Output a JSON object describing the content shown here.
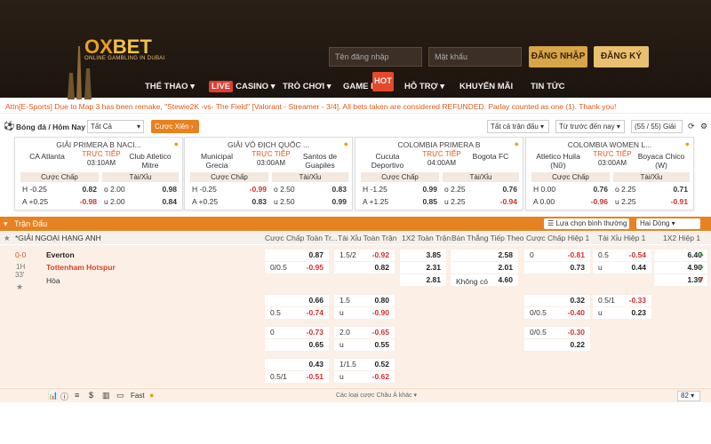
{
  "brand": {
    "logo_main": "OX",
    "logo_accent": "BET",
    "tagline": "ONLINE GAMBLING IN DUBAI"
  },
  "login": {
    "username_placeholder": "Tên đăng nhập",
    "password_placeholder": "Mật khẩu",
    "login_label": "ĐĂNG NHẬP",
    "register_label": "ĐĂNG KÝ"
  },
  "nav": {
    "items": [
      "THỂ THAO",
      "CASINO",
      "TRÒ CHƠI",
      "GAME BÀI",
      "HỖ TRỢ",
      "KHUYẾN MÃI",
      "TIN TỨC"
    ],
    "live_badge": "LIVE",
    "hot_badge": "HOT"
  },
  "ticker": "Attn[E-Sports] Due to Map 3 has been remake, \"Stewie2K -vs- The Field\" [Valorant - Streamer - 3/4]. All bets taken are considered REFUNDED. Parlay counted as one (1). Thank you!",
  "filters": {
    "sport_label": "Bóng đá / Hôm Nay",
    "league_value": "Tất Cả",
    "parlay_label": "Cược Xiên",
    "all_matches": "Tất cả trận đấu",
    "sort_value": "Từ trước đến nay",
    "count": "(55 / 55) Giải"
  },
  "cards": [
    {
      "league": "GIẢI PRIMERA B NACI...",
      "home": "CA Atlanta",
      "away": "Club Atletico Mitre",
      "live": "TRỰC TIẾP",
      "time": "03:10AM",
      "hdp_label": "Cược Chấp",
      "ou_label": "Tài/Xỉu",
      "rows": [
        [
          "H -0.25",
          "0.82",
          "o 2.00",
          "0.98"
        ],
        [
          "A +0.25",
          "-0.98",
          "u 2.00",
          "0.84"
        ]
      ]
    },
    {
      "league": "GIẢI VÔ ĐỊCH QUỐC ...",
      "home": "Municipal Grecia",
      "away": "Santos de Guapiles",
      "live": "TRỰC TIẾP",
      "time": "03:00AM",
      "hdp_label": "Cược Chấp",
      "ou_label": "Tài/Xỉu",
      "rows": [
        [
          "H -0.25",
          "-0.99",
          "o 2.50",
          "0.83"
        ],
        [
          "A +0.25",
          "0.83",
          "u 2.50",
          "0.99"
        ]
      ]
    },
    {
      "league": "COLOMBIA PRIMERA B",
      "home": "Cucuta Deportivo",
      "away": "Bogota FC",
      "live": "TRỰC TIẾP",
      "time": "04:00AM",
      "hdp_label": "Cược Chấp",
      "ou_label": "Tài/Xỉu",
      "rows": [
        [
          "H -1.25",
          "0.99",
          "o 2.25",
          "0.76"
        ],
        [
          "A +1.25",
          "0.85",
          "u 2.25",
          "-0.94"
        ]
      ]
    },
    {
      "league": "COLOMBIA WOMEN L...",
      "home": "Atletico Huila (Nữ)",
      "away": "Boyaca Chico (W)",
      "live": "TRỰC TIẾP",
      "time": "03:00AM",
      "hdp_label": "Cược Chấp",
      "ou_label": "Tài/Xỉu",
      "rows": [
        [
          "H 0.00",
          "0.76",
          "o 2.25",
          "0.71"
        ],
        [
          "A 0.00",
          "-0.96",
          "u 2.25",
          "-0.91"
        ]
      ]
    }
  ],
  "section": {
    "title": "Trận Đấu",
    "view_label": "Lựa chọn bình thường",
    "odds_type": "Hai Dòng"
  },
  "columns": [
    "Cược Chấp Toàn Tr...",
    "Tài Xỉu Toàn Trận",
    "1X2 Toàn Trận",
    "Bàn Thắng Tiếp Theo",
    "Cược Chấp Hiệp 1",
    "Tài Xỉu Hiệp 1",
    "1X2 Hiệp 1"
  ],
  "league_row": "*GIẢI NGOẠI HẠNG ANH",
  "match": {
    "score_home": "0",
    "score_away": "0",
    "period": "1H",
    "minute": "33'",
    "home": "Everton",
    "away": "Tottenham Hotspur",
    "draw": "Hòa",
    "no_goal": "Không có"
  },
  "odds": {
    "r1": [
      [
        "",
        "0.87"
      ],
      [
        "1.5/2",
        "-0.92"
      ],
      [
        "",
        "3.85"
      ],
      [
        "",
        "2.58"
      ],
      [
        "0",
        "-0.81"
      ],
      [
        "0.5",
        "-0.54"
      ],
      [
        "",
        "6.40"
      ]
    ],
    "r2": [
      [
        "0/0.5",
        "-0.95"
      ],
      [
        "",
        "0.82"
      ],
      [
        "",
        "2.31"
      ],
      [
        "",
        "2.01"
      ],
      [
        "",
        "0.73"
      ],
      [
        "u",
        "0.44"
      ],
      [
        "",
        "4.90"
      ]
    ],
    "r3": [
      [
        "",
        "2.81"
      ],
      [
        "",
        "4.60"
      ],
      [
        "",
        "1.39"
      ]
    ],
    "b2": [
      [
        "",
        "0.66"
      ],
      [
        "1.5",
        "0.80"
      ],
      [
        "",
        "0.32"
      ],
      [
        "0.5/1",
        "-0.33"
      ],
      [
        "0.5",
        "-0.74"
      ],
      [
        "u",
        "-0.90"
      ],
      [
        "0/0.5",
        "-0.40"
      ],
      [
        "u",
        "0.23"
      ]
    ],
    "b3": [
      [
        "0",
        "-0.73"
      ],
      [
        "2.0",
        "-0.65"
      ],
      [
        "0/0.5",
        "-0.30"
      ],
      [
        "",
        "0.65"
      ],
      [
        "u",
        "0.55"
      ],
      [
        "",
        "0.22"
      ]
    ],
    "b4": [
      [
        "",
        "0.43"
      ],
      [
        "1/1.5",
        "0.52"
      ],
      [
        "0.5/1",
        "-0.51"
      ],
      [
        "u",
        "-0.62"
      ]
    ]
  },
  "footer": {
    "more_label": "Các loại cược Châu Á khác",
    "fast_label": "Fast",
    "page_value": "82"
  }
}
